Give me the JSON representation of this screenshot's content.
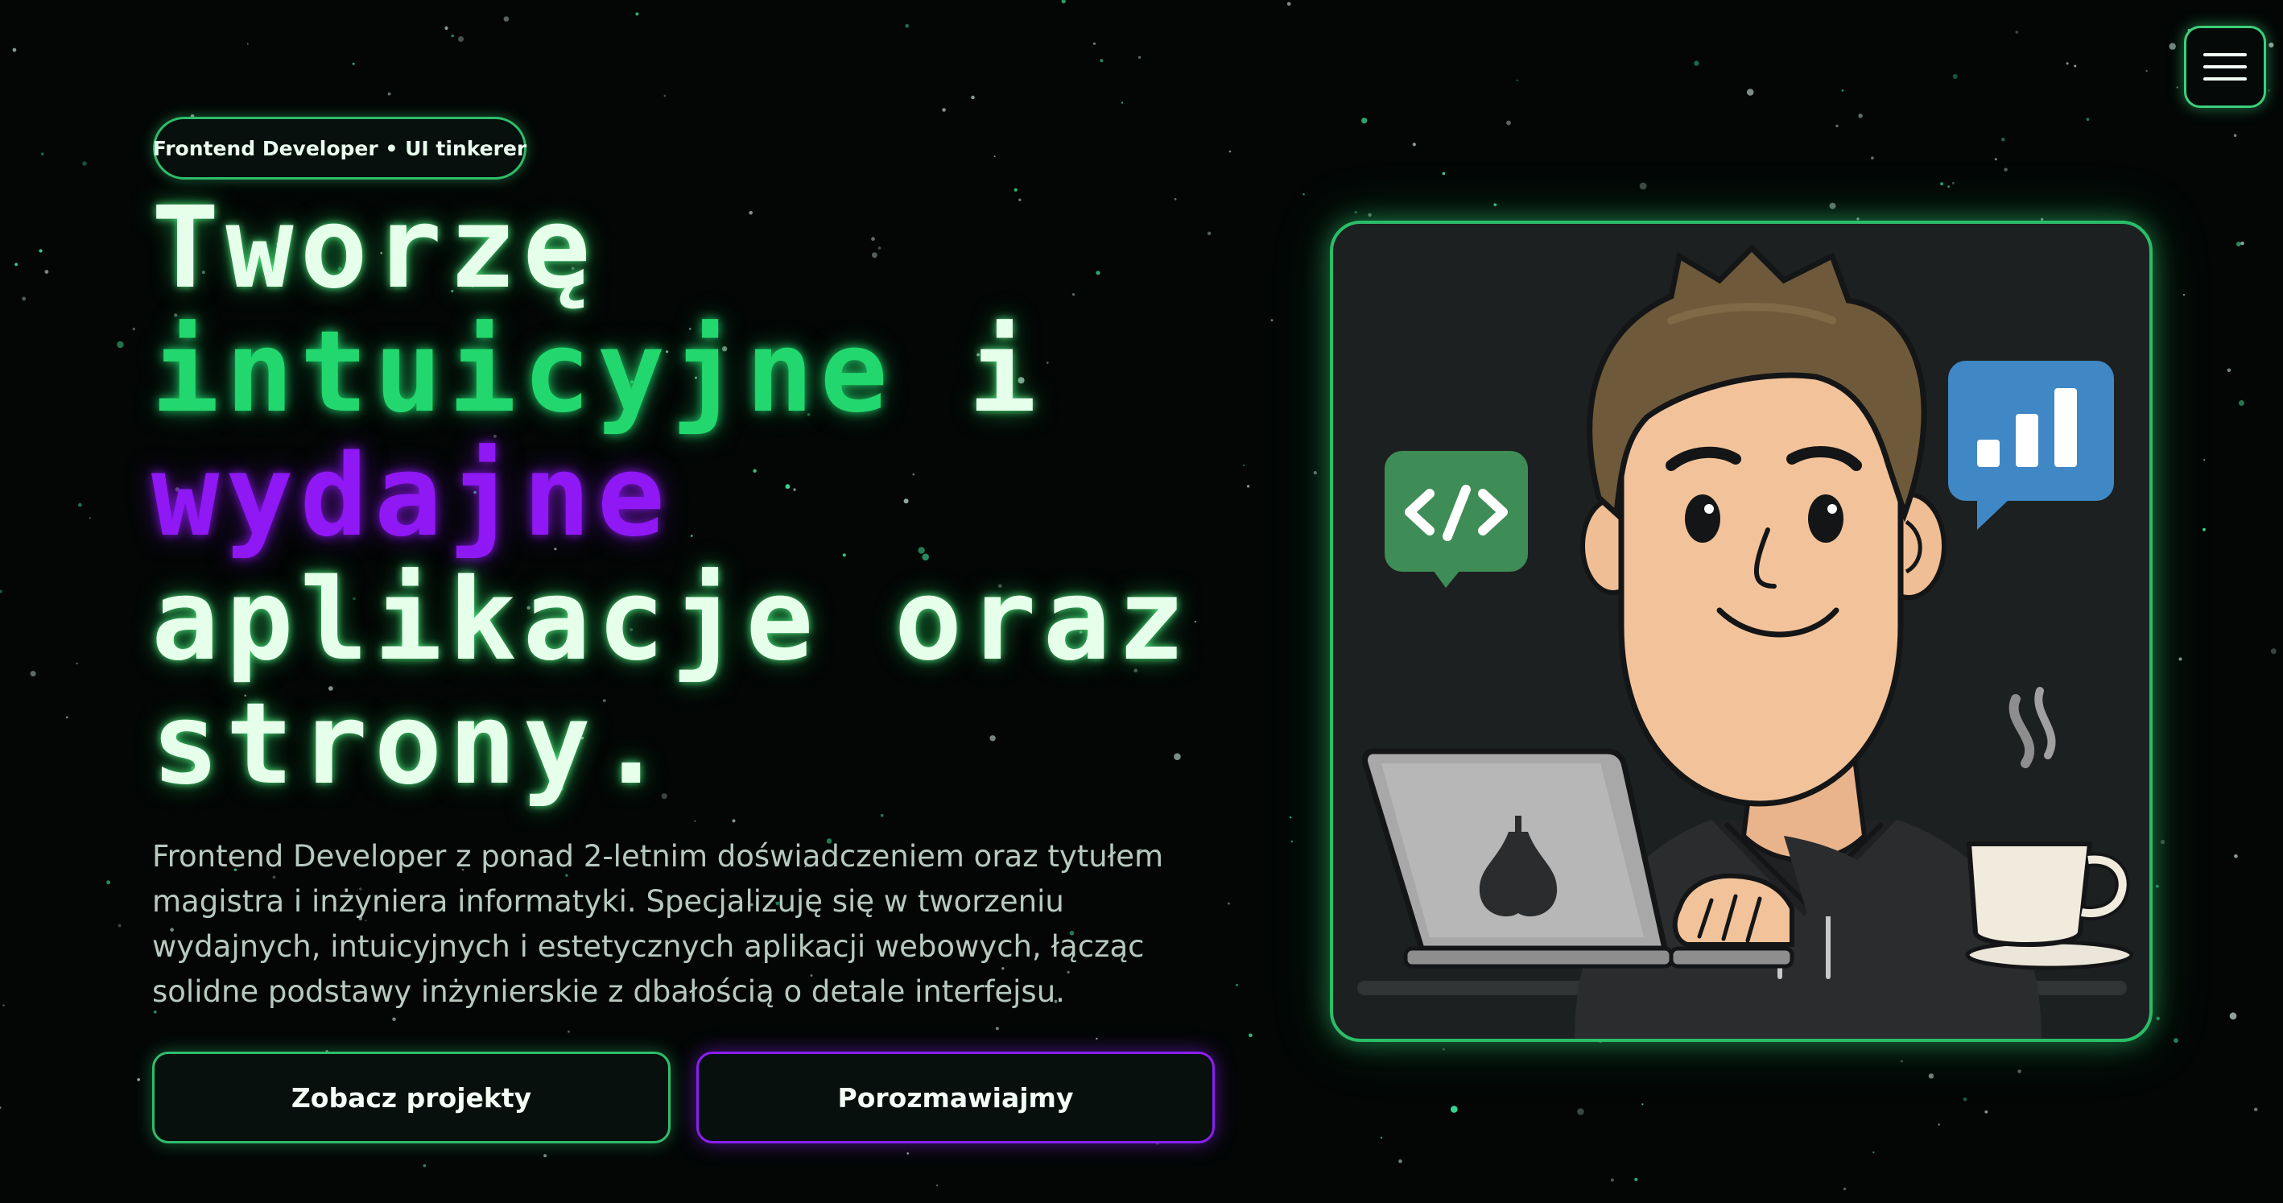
{
  "header": {
    "menu_icon": "hamburger-menu-icon"
  },
  "hero": {
    "badge": "Frontend Developer • UI tinkerer",
    "headline": {
      "line1": "Tworzę",
      "line2_accent": "intuicyjne",
      "line2_rest": "i",
      "line3_accent": "wydajne",
      "line4": "aplikacje oraz",
      "line5": "strony."
    },
    "description": "Frontend Developer z ponad 2-letnim doświadczeniem oraz tytułem magistra i inżyniera informatyki. Specjalizuję się w tworzeniu wydajnych, intuicyjnych i estetycznych aplikacji webowych, łącząc solidne podstawy inżynierskie z dbałością o detale interfejsu.",
    "buttons": {
      "projects": "Zobacz projekty",
      "contact": "Porozmawiajmy"
    }
  },
  "illustration": {
    "icons": [
      "developer-avatar-illustration",
      "code-bubble-icon",
      "chart-bubble-icon",
      "laptop-icon",
      "pear-logo-icon",
      "coffee-cup-icon"
    ]
  },
  "colors": {
    "background": "#030605",
    "neon_green": "#22d86e",
    "neon_purple": "#8f18f5",
    "headline_light": "#e6ffeb",
    "body_text": "#b8c9bf"
  }
}
